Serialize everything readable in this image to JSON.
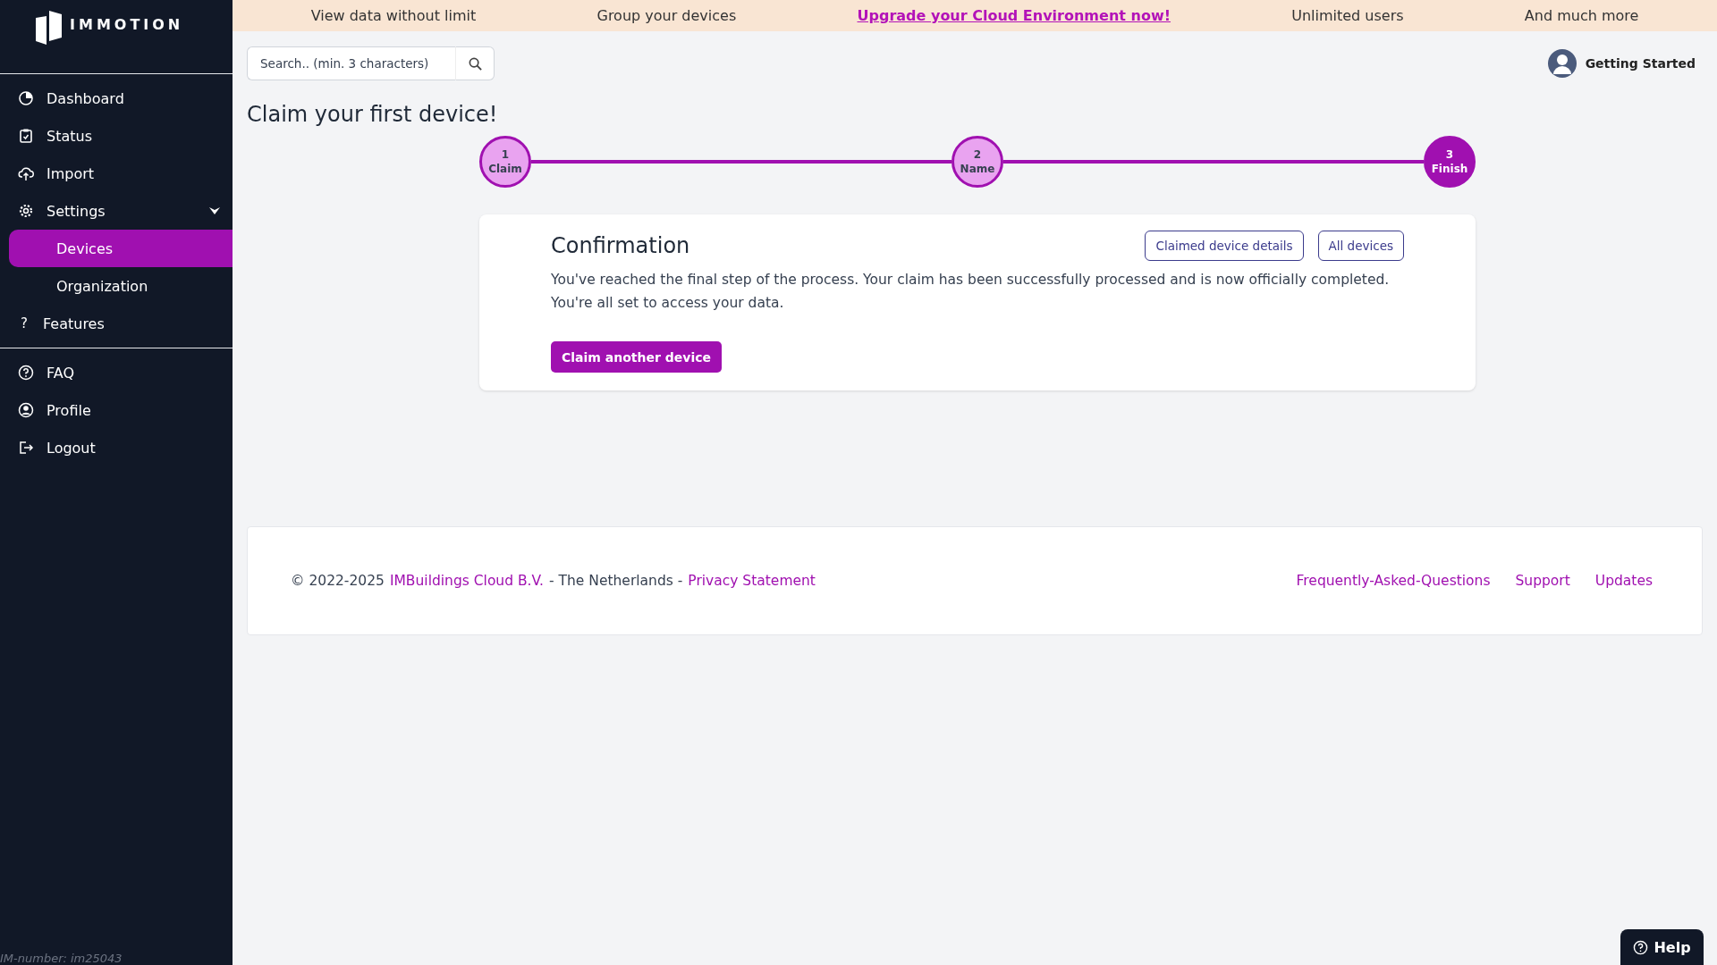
{
  "sidebar": {
    "logo": "IMMOTION",
    "groups": [
      [
        {
          "label": "Dashboard"
        },
        {
          "label": "Status"
        },
        {
          "label": "Import"
        },
        {
          "label": "Settings",
          "expanded": true,
          "children": [
            {
              "label": "Devices",
              "selected": true
            },
            {
              "label": "Organization",
              "selected": false
            }
          ]
        },
        {
          "label": "Features",
          "glyph": "?"
        }
      ],
      [
        {
          "label": "FAQ"
        },
        {
          "label": "Profile"
        },
        {
          "label": "Logout"
        }
      ]
    ],
    "footer_note": "IM-number: im25043"
  },
  "banner": [
    {
      "text": "View data without limit",
      "link": false
    },
    {
      "text": "Group your devices",
      "link": false
    },
    {
      "text": "Upgrade your Cloud Environment now!",
      "link": true
    },
    {
      "text": "Unlimited users",
      "link": false
    },
    {
      "text": "And much more",
      "link": false
    }
  ],
  "search": {
    "placeholder": "Search.. (min. 3 characters)"
  },
  "user": {
    "name": "Getting Started"
  },
  "page_title": "Claim your first device!",
  "steps": [
    {
      "number": "1",
      "label": "Claim",
      "selected": false
    },
    {
      "number": "2",
      "label": "Name",
      "selected": false
    },
    {
      "number": "3",
      "label": "Finish",
      "selected": true
    }
  ],
  "card": {
    "title": "Confirmation",
    "buttons": [
      "Claimed device details",
      "All devices"
    ],
    "text": [
      "You've reached the final step of the process. Your claim has been successfully processed and is now officially completed.",
      "You're all set to access your data."
    ],
    "primary_button": "Claim another device"
  },
  "footer": {
    "copyright": "© 2022-2025",
    "company": "IMBuildings Cloud B.V.",
    "sep1": "- The Netherlands -",
    "privacy": "Privacy Statement",
    "links": [
      "Frequently-Asked-Questions",
      "Support",
      "Updates"
    ]
  },
  "help": {
    "label": "Help"
  }
}
